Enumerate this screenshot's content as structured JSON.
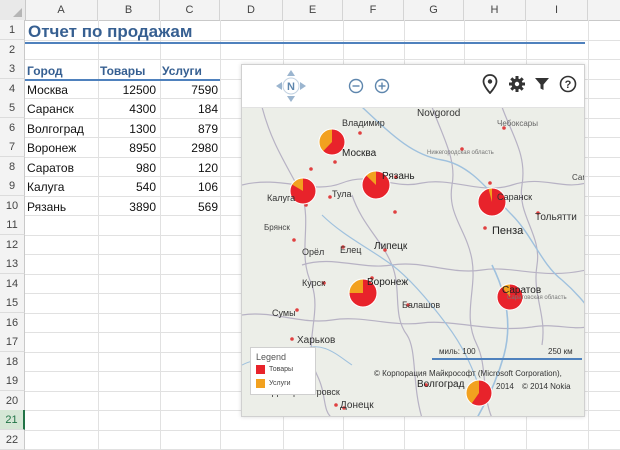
{
  "columns": [
    "A",
    "B",
    "C",
    "D",
    "E",
    "F",
    "G",
    "H",
    "I"
  ],
  "rows": [
    "1",
    "2",
    "3",
    "4",
    "5",
    "6",
    "7",
    "8",
    "9",
    "10",
    "11",
    "12",
    "13",
    "14",
    "15",
    "16",
    "17",
    "18",
    "19",
    "20",
    "21",
    "22"
  ],
  "active_row": "21",
  "title": "Отчет по продажам",
  "table": {
    "headers": [
      "Город",
      "Товары",
      "Услуги"
    ],
    "rows": [
      {
        "city": "Москва",
        "goods": "12500",
        "services": "7590"
      },
      {
        "city": "Саранск",
        "goods": "4300",
        "services": "184"
      },
      {
        "city": "Волгоград",
        "goods": "1300",
        "services": "879"
      },
      {
        "city": "Воронеж",
        "goods": "8950",
        "services": "2980"
      },
      {
        "city": "Саратов",
        "goods": "980",
        "services": "120"
      },
      {
        "city": "Калуга",
        "goods": "540",
        "services": "106"
      },
      {
        "city": "Рязань",
        "goods": "3890",
        "services": "569"
      }
    ]
  },
  "map": {
    "compass_label": "N",
    "zoom_out_label": "−",
    "zoom_in_label": "+",
    "help_label": "?",
    "labels": {
      "vladimir": "Владимир",
      "novgorod": "Novgorod",
      "cheboksary": "Чебоксары",
      "moskva": "Москва",
      "nizh_obl": "Нижегородская область",
      "ryazan": "Рязань",
      "kaluga": "Калуга",
      "tula": "Тула",
      "saransk": "Саранск",
      "bryansk": "Брянск",
      "tolyatti": "Тольятти",
      "orel": "Орёл",
      "elets": "Елец",
      "lipetsk": "Липецк",
      "penza": "Пенза",
      "voronezh": "Воронеж",
      "kursk": "Курск",
      "balashov": "Балашов",
      "saratov": "Саратов",
      "sar_obl": "Саратовская область",
      "sumy": "Сумы",
      "kharkov": "Харьков",
      "volgograd": "Волгоград",
      "dnepr": "Днепропетровск",
      "donetsk": "Донецк",
      "samara_s": "Сам"
    },
    "legend": {
      "title": "Legend",
      "goods": "Товары",
      "services": "Услуги"
    },
    "scale_miles": "миль: 100",
    "scale_km": "250 км",
    "copyright_line1": "© Корпорация Майкрософт (Microsoft Corporation),",
    "copyright_year": "2014",
    "copyright_nokia": "© 2014 Nokia",
    "colors": {
      "goods": "#e8232b",
      "services": "#f2a11f"
    },
    "pies": [
      {
        "city": "Москва",
        "goods": 12500,
        "services": 7590
      },
      {
        "city": "Калуга",
        "goods": 540,
        "services": 106
      },
      {
        "city": "Рязань",
        "goods": 3890,
        "services": 569
      },
      {
        "city": "Саранск",
        "goods": 4300,
        "services": 184
      },
      {
        "city": "Воронеж",
        "goods": 8950,
        "services": 2980
      },
      {
        "city": "Саратов",
        "goods": 980,
        "services": 120
      },
      {
        "city": "Волгоград",
        "goods": 1300,
        "services": 879
      }
    ]
  }
}
